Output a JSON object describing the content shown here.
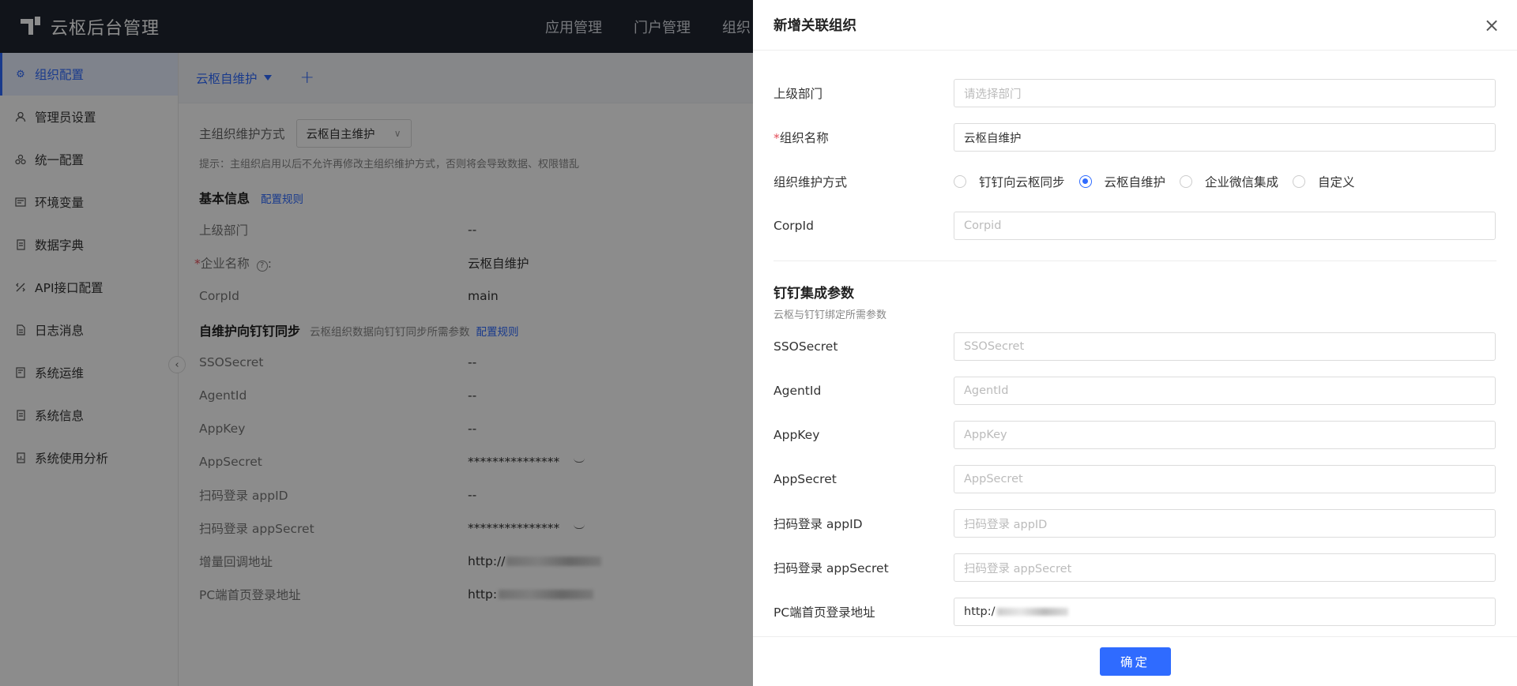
{
  "app": {
    "title": "云枢后台管理",
    "topnav": [
      "应用管理",
      "门户管理",
      "组织"
    ]
  },
  "sidebar": {
    "items": [
      {
        "label": "组织配置",
        "icon": "gear-icon"
      },
      {
        "label": "管理员设置",
        "icon": "user-icon"
      },
      {
        "label": "统一配置",
        "icon": "cluster-icon"
      },
      {
        "label": "环境变量",
        "icon": "terminal-icon"
      },
      {
        "label": "数据字典",
        "icon": "book-icon"
      },
      {
        "label": "API接口配置",
        "icon": "api-icon"
      },
      {
        "label": "日志消息",
        "icon": "log-icon"
      },
      {
        "label": "系统运维",
        "icon": "ops-icon"
      },
      {
        "label": "系统信息",
        "icon": "info-icon"
      },
      {
        "label": "系统使用分析",
        "icon": "analysis-icon"
      }
    ]
  },
  "main": {
    "tab_label": "云枢自维护",
    "add_tab": "+",
    "maint_label": "主组织维护方式",
    "maint_value": "云枢自主维护",
    "hint": "提示：主组织启用以后不允许再修改主组织维护方式，否则将会导致数据、权限错乱",
    "basic_title": "基本信息",
    "config_rule": "配置规则",
    "basic_rows": [
      {
        "k": "上级部门",
        "v": "--"
      },
      {
        "k": "企业名称",
        "v": "云枢自维护"
      },
      {
        "k": "CorpId",
        "v": "main"
      }
    ],
    "required_mark": "*",
    "help_mark": "?",
    "colon": ":",
    "sync_title": "自维护向钉钉同步",
    "sync_desc": "云枢组织数据向钉钉同步所需参数",
    "sync_rows": [
      {
        "k": "SSOSecret",
        "v": "--"
      },
      {
        "k": "AgentId",
        "v": "--"
      },
      {
        "k": "AppKey",
        "v": "--"
      },
      {
        "k": "AppSecret",
        "v": "***************"
      },
      {
        "k": "扫码登录 appID",
        "v": "--"
      },
      {
        "k": "扫码登录 appSecret",
        "v": "***************"
      },
      {
        "k": "增量回调地址",
        "v": "http://"
      },
      {
        "k": "PC端首页登录地址",
        "v": "http:"
      }
    ]
  },
  "drawer": {
    "title": "新增关联组织",
    "close": "×",
    "required_mark": "*",
    "parent_label": "上级部门",
    "parent_placeholder": "请选择部门",
    "name_label": "组织名称",
    "name_value": "云枢自维护",
    "method_label": "组织维护方式",
    "methods": [
      {
        "label": "钉钉向云枢同步",
        "checked": false
      },
      {
        "label": "云枢自维护",
        "checked": true
      },
      {
        "label": "企业微信集成",
        "checked": false
      },
      {
        "label": "自定义",
        "checked": false
      }
    ],
    "corp_label": "CorpId",
    "corp_placeholder": "Corpid",
    "group_title": "钉钉集成参数",
    "group_sub": "云枢与钉钉绑定所需参数",
    "params": [
      {
        "label": "SSOSecret",
        "placeholder": "SSOSecret",
        "value": ""
      },
      {
        "label": "AgentId",
        "placeholder": "AgentId",
        "value": ""
      },
      {
        "label": "AppKey",
        "placeholder": "AppKey",
        "value": ""
      },
      {
        "label": "AppSecret",
        "placeholder": "AppSecret",
        "value": ""
      },
      {
        "label": "扫码登录 appID",
        "placeholder": "扫码登录 appID",
        "value": ""
      },
      {
        "label": "扫码登录 appSecret",
        "placeholder": "扫码登录 appSecret",
        "value": ""
      },
      {
        "label": "PC端首页登录地址",
        "placeholder": "",
        "value": "http:/"
      }
    ],
    "confirm": "确定"
  },
  "colors": {
    "primary": "#2f6bff",
    "topbar": "#1f2530",
    "required": "#e34d59"
  }
}
